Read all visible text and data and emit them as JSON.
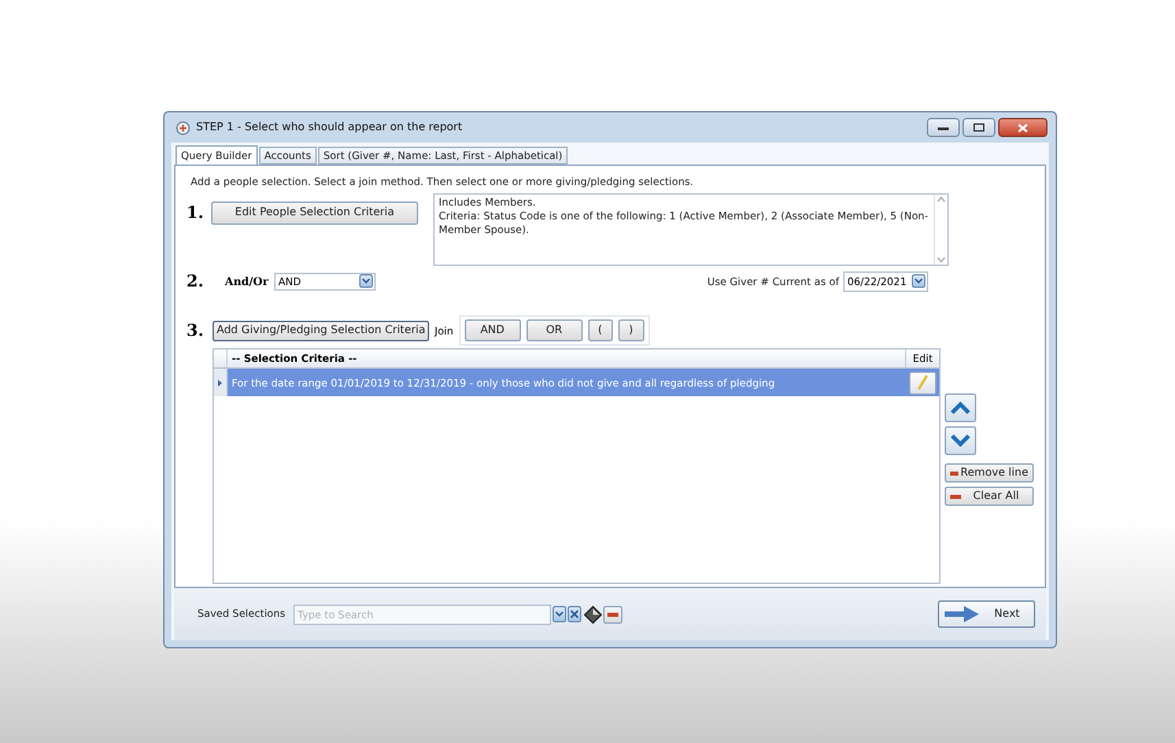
{
  "window": {
    "title": "STEP 1 - Select who should appear on the report"
  },
  "tabs": [
    {
      "label": "Query Builder",
      "selected": true
    },
    {
      "label": "Accounts",
      "selected": false
    },
    {
      "label": "Sort (Giver #, Name: Last, First - Alphabetical)",
      "selected": false
    }
  ],
  "instructions": "Add a people selection.  Select a join method.  Then select one or more giving/pledging selections.",
  "step1": {
    "number": "1.",
    "button": "Edit People Selection Criteria",
    "description": "Includes Members.\nCriteria: Status Code is one of the following: 1 (Active Member), 2 (Associate Member), 5 (Non-Member Spouse)."
  },
  "step2": {
    "number": "2.",
    "label": "And/Or",
    "value": "AND",
    "giver_label": "Use Giver # Current as of",
    "giver_date": "06/22/2021"
  },
  "step3": {
    "number": "3.",
    "button": "Add Giving/Pledging Selection Criteria",
    "join_label": "Join",
    "join_buttons": [
      "AND",
      "OR",
      "(",
      ")"
    ]
  },
  "grid": {
    "columns": [
      "-- Selection Criteria --",
      "Edit"
    ],
    "rows": [
      {
        "text": "For the date range 01/01/2019 to 12/31/2019 - only those who did not give and all regardless of pledging",
        "selected": true
      }
    ]
  },
  "side_buttons": [
    "Remove line",
    "Clear All"
  ],
  "saved_selections": {
    "label": "Saved Selections",
    "placeholder": "Type to Search"
  },
  "next_button": "Next"
}
